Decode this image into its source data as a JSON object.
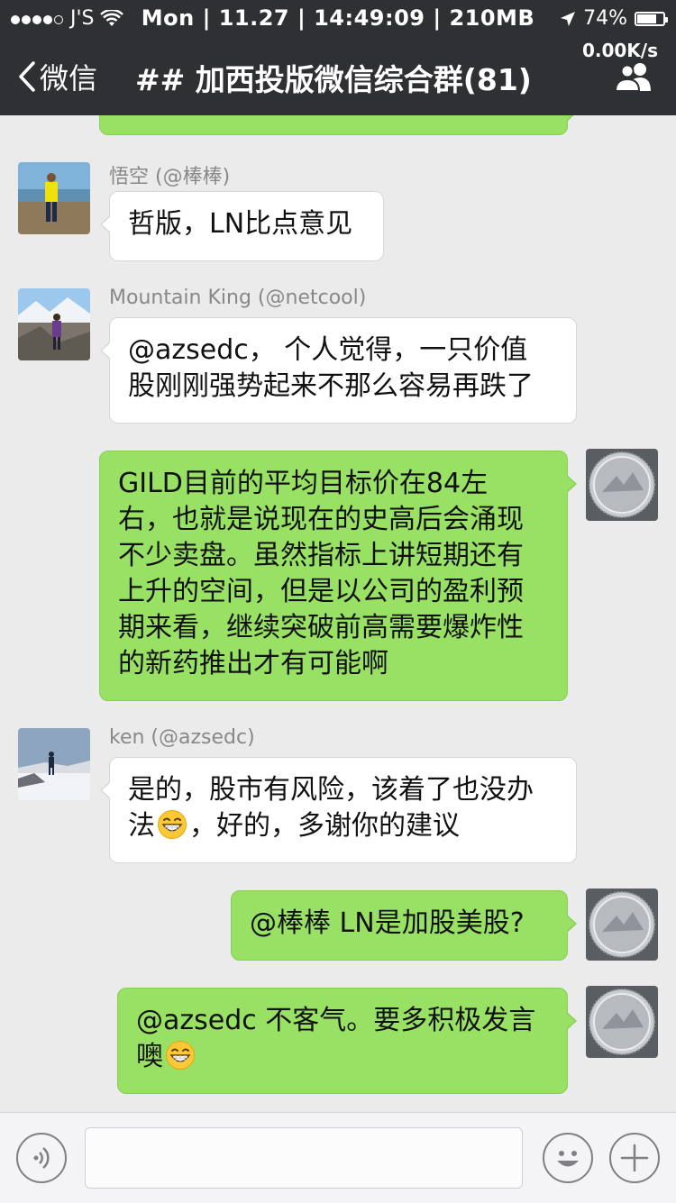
{
  "status_bar": {
    "carrier": "J'S",
    "center": "Mon | 11.27 | 14:49:09 | 210MB",
    "battery": "74%"
  },
  "nav": {
    "back_label": "微信",
    "title": "## 加西投版微信综合群(81)",
    "net_speed": "0.00K/s"
  },
  "messages": [
    {
      "sender": "悟空 (@棒棒)",
      "lines": [
        "哲版，LN比点意见"
      ]
    },
    {
      "sender": "Mountain King (@netcool)",
      "lines": [
        "@azsedc， 个人觉得，一只价值",
        "股刚刚强势起来不那么容易再跌了"
      ]
    },
    {
      "lines": [
        "GILD目前的平均目标价在84左",
        "右，也就是说现在的史高后会涌现",
        "不少卖盘。虽然指标上讲短期还有",
        "上升的空间，但是以公司的盈利预",
        "期来看，继续突破前高需要爆炸性",
        "的新药推出才有可能啊"
      ]
    },
    {
      "sender": "ken (@azsedc)",
      "line1": "是的，股市有风险，该着了也没办",
      "line2_a": "法",
      "line2_b": "，好的，多谢你的建议"
    },
    {
      "lines": [
        "@棒棒 LN是加股美股?"
      ]
    },
    {
      "line1": "@azsedc 不客气。要多积极发言",
      "line2": "噢"
    }
  ],
  "input": {
    "value": "",
    "placeholder": ""
  },
  "colors": {
    "nav_bg": "#2f3034",
    "chat_bg": "#ebebeb",
    "outgoing_bubble": "#98e165",
    "incoming_bubble": "#ffffff"
  }
}
